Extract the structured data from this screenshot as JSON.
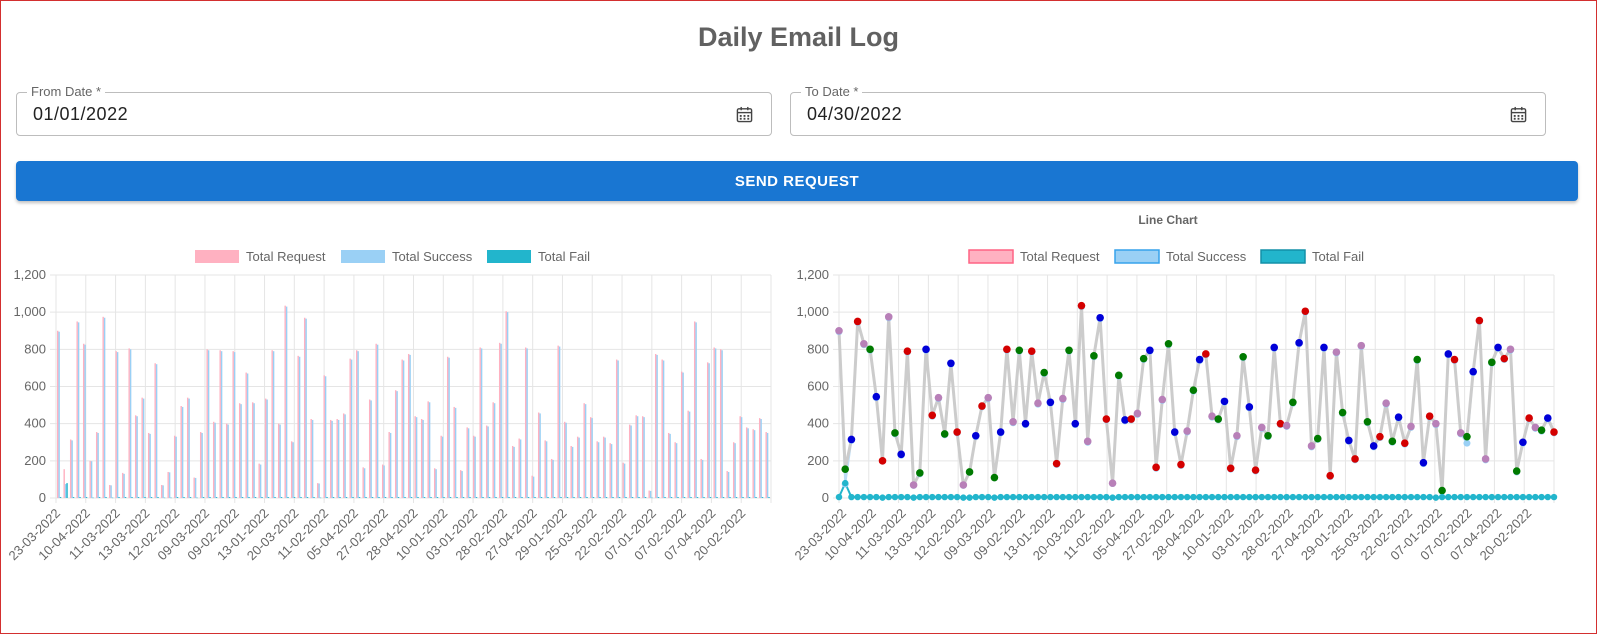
{
  "page": {
    "title": "Daily Email Log"
  },
  "form": {
    "from": {
      "label": "From Date *",
      "value": "01/01/2022"
    },
    "to": {
      "label": "To Date *",
      "value": "04/30/2022"
    },
    "submit_label": "SEND REQUEST"
  },
  "icons": {
    "date_picker": "calendar-icon"
  },
  "colors": {
    "accent": "#1976d2",
    "request": "#ffb1c1",
    "success": "#9ad0f5",
    "fail": "#22b5cc",
    "line": "#cccccc",
    "dot_palette": [
      "#d40000",
      "#0000d8",
      "#007a00",
      "#b880b8"
    ]
  },
  "chart_data": [
    {
      "type": "bar",
      "title": "",
      "legend": [
        "Total Request",
        "Total Success",
        "Total Fail"
      ],
      "legend_position": "top",
      "grid": true,
      "ylim": [
        0,
        1200
      ],
      "yticks": [
        "0",
        "200",
        "400",
        "600",
        "800",
        "1,000",
        "1,200"
      ],
      "xtick_labels": [
        "23-03-2022",
        "10-04-2022",
        "11-03-2022",
        "13-03-2022",
        "12-02-2022",
        "09-03-2022",
        "09-02-2022",
        "13-01-2022",
        "20-03-2022",
        "11-02-2022",
        "05-04-2022",
        "27-02-2022",
        "28-04-2022",
        "10-01-2022",
        "03-01-2022",
        "28-02-2022",
        "27-04-2022",
        "29-01-2022",
        "25-03-2022",
        "22-02-2022",
        "07-01-2022",
        "07-02-2022",
        "07-04-2022",
        "20-02-2022"
      ],
      "series": [
        {
          "name": "Total Request",
          "values": [
            900,
            155,
            315,
            950,
            830,
            200,
            355,
            975,
            70,
            790,
            135,
            805,
            445,
            540,
            350,
            725,
            70,
            140,
            335,
            495,
            540,
            110,
            355,
            800,
            410,
            795,
            400,
            790,
            510,
            675,
            515,
            185,
            535,
            795,
            400,
            1035,
            305,
            765,
            970,
            425,
            80,
            660,
            420,
            425,
            455,
            750,
            795,
            165,
            530,
            830,
            180,
            355,
            580,
            745,
            775,
            440,
            425,
            520,
            160,
            335,
            760,
            490,
            150,
            380,
            335,
            810,
            390,
            515,
            835,
            1005,
            280,
            320,
            810,
            120,
            460,
            310,
            210,
            820,
            410,
            280,
            330,
            510,
            435,
            305,
            330,
            295,
            745,
            190,
            395,
            445,
            440,
            40,
            775,
            745,
            350,
            300,
            680,
            470,
            950,
            210,
            730,
            810,
            800,
            145,
            300,
            440,
            380,
            370,
            430,
            355
          ]
        },
        {
          "name": "Total Success",
          "values": [
            895,
            75,
            310,
            945,
            825,
            198,
            350,
            970,
            68,
            785,
            130,
            800,
            440,
            535,
            345,
            720,
            68,
            138,
            330,
            490,
            535,
            108,
            350,
            795,
            405,
            790,
            395,
            785,
            505,
            670,
            510,
            180,
            530,
            790,
            395,
            1030,
            300,
            760,
            965,
            420,
            78,
            655,
            415,
            420,
            450,
            745,
            790,
            160,
            525,
            825,
            175,
            350,
            575,
            740,
            770,
            435,
            420,
            515,
            155,
            330,
            755,
            485,
            145,
            375,
            330,
            805,
            385,
            510,
            830,
            1000,
            275,
            315,
            805,
            115,
            455,
            305,
            205,
            815,
            405,
            275,
            325,
            505,
            430,
            300,
            325,
            290,
            740,
            185,
            390,
            440,
            435,
            38,
            770,
            740,
            345,
            295,
            675,
            465,
            945,
            205,
            725,
            805,
            795,
            140,
            295,
            435,
            375,
            365,
            425,
            350
          ]
        },
        {
          "name": "Total Fail",
          "values": [
            5,
            80,
            5,
            5,
            5,
            2,
            5,
            5,
            2,
            5,
            5,
            5,
            5,
            5,
            5,
            5,
            2,
            2,
            5,
            5,
            5,
            2,
            5,
            5,
            5,
            5,
            5,
            5,
            5,
            5,
            5,
            5,
            5,
            5,
            5,
            5,
            5,
            5,
            5,
            5,
            2,
            5,
            5,
            5,
            5,
            5,
            5,
            5,
            5,
            5,
            5,
            5,
            5,
            5,
            5,
            5,
            5,
            5,
            5,
            5,
            5,
            5,
            5,
            5,
            5,
            5,
            5,
            5,
            5,
            5,
            5,
            5,
            5,
            5,
            5,
            5,
            5,
            5,
            5,
            5,
            5,
            5,
            5,
            5,
            5,
            5,
            5,
            5,
            5,
            5,
            5,
            2,
            5,
            5,
            5,
            5,
            5,
            5,
            5,
            5,
            5,
            5,
            5,
            5,
            5,
            5,
            5,
            5,
            5,
            5
          ]
        }
      ]
    },
    {
      "type": "line",
      "title": "Line Chart",
      "legend": [
        "Total Request",
        "Total Success",
        "Total Fail"
      ],
      "legend_position": "top",
      "grid": true,
      "ylim": [
        0,
        1200
      ],
      "yticks": [
        "0",
        "200",
        "400",
        "600",
        "800",
        "1,000",
        "1,200"
      ],
      "xtick_labels": [
        "23-03-2022",
        "10-04-2022",
        "11-03-2022",
        "13-03-2022",
        "12-02-2022",
        "09-03-2022",
        "09-02-2022",
        "13-01-2022",
        "20-03-2022",
        "11-02-2022",
        "05-04-2022",
        "27-02-2022",
        "28-04-2022",
        "10-01-2022",
        "03-01-2022",
        "28-02-2022",
        "27-04-2022",
        "29-01-2022",
        "25-03-2022",
        "22-02-2022",
        "07-01-2022",
        "07-02-2022",
        "07-04-2022",
        "20-02-2022"
      ],
      "series": [
        {
          "name": "Total Request",
          "values": [
            900,
            155,
            315,
            950,
            830,
            800,
            545,
            200,
            975,
            350,
            235,
            790,
            70,
            135,
            800,
            445,
            540,
            345,
            725,
            355,
            70,
            140,
            335,
            495,
            540,
            110,
            355,
            800,
            410,
            795,
            400,
            790,
            510,
            675,
            515,
            185,
            535,
            795,
            400,
            1035,
            305,
            765,
            970,
            425,
            80,
            660,
            420,
            425,
            455,
            750,
            795,
            165,
            530,
            830,
            355,
            180,
            360,
            580,
            745,
            775,
            440,
            425,
            520,
            160,
            335,
            760,
            490,
            150,
            380,
            335,
            810,
            400,
            390,
            515,
            835,
            1005,
            280,
            320,
            810,
            120,
            785,
            460,
            310,
            210,
            820,
            410,
            280,
            330,
            510,
            305,
            435,
            295,
            385,
            745,
            190,
            440,
            400,
            40,
            775,
            745,
            350,
            330,
            680,
            955,
            210,
            730,
            810,
            750,
            800,
            145,
            300,
            430,
            380,
            365,
            430,
            355
          ]
        },
        {
          "name": "Total Success",
          "values": [
            895,
            75,
            310,
            945,
            825,
            795,
            540,
            198,
            970,
            345,
            230,
            785,
            68,
            130,
            795,
            440,
            535,
            340,
            720,
            350,
            68,
            138,
            330,
            490,
            535,
            108,
            350,
            795,
            405,
            790,
            395,
            785,
            505,
            670,
            510,
            180,
            530,
            790,
            395,
            1030,
            300,
            760,
            965,
            420,
            78,
            655,
            415,
            420,
            450,
            745,
            790,
            160,
            525,
            825,
            350,
            175,
            355,
            575,
            740,
            770,
            435,
            420,
            515,
            155,
            330,
            755,
            485,
            145,
            375,
            330,
            805,
            395,
            385,
            510,
            830,
            1000,
            275,
            315,
            805,
            115,
            780,
            455,
            305,
            205,
            815,
            405,
            275,
            325,
            505,
            300,
            430,
            290,
            380,
            740,
            185,
            435,
            395,
            38,
            770,
            740,
            345,
            295,
            675,
            950,
            205,
            725,
            805,
            745,
            795,
            140,
            295,
            425,
            375,
            360,
            425,
            350
          ]
        },
        {
          "name": "Total Fail",
          "values": [
            5,
            80,
            5,
            5,
            5,
            5,
            5,
            2,
            5,
            5,
            5,
            5,
            2,
            5,
            5,
            5,
            5,
            5,
            5,
            5,
            2,
            2,
            5,
            5,
            5,
            2,
            5,
            5,
            5,
            5,
            5,
            5,
            5,
            5,
            5,
            5,
            5,
            5,
            5,
            5,
            5,
            5,
            5,
            5,
            2,
            5,
            5,
            5,
            5,
            5,
            5,
            5,
            5,
            5,
            5,
            5,
            5,
            5,
            5,
            5,
            5,
            5,
            5,
            5,
            5,
            5,
            5,
            5,
            5,
            5,
            5,
            5,
            5,
            5,
            5,
            5,
            5,
            5,
            5,
            5,
            5,
            5,
            5,
            5,
            5,
            5,
            5,
            5,
            5,
            5,
            5,
            5,
            5,
            5,
            5,
            5,
            2,
            5,
            5,
            5,
            5,
            5,
            5,
            5,
            5,
            5,
            5,
            5,
            5,
            5,
            5,
            5,
            5,
            5,
            5,
            5
          ]
        }
      ]
    }
  ]
}
